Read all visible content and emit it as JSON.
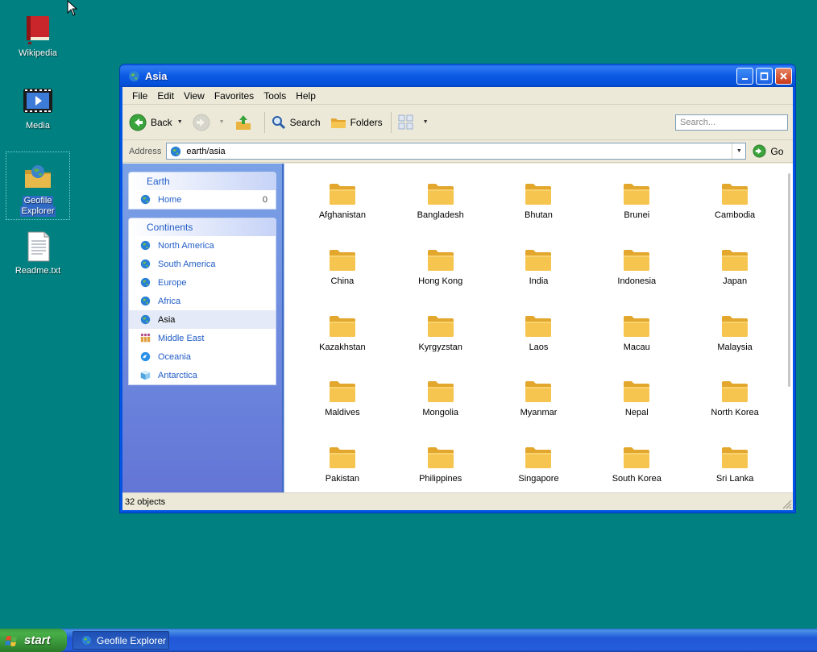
{
  "desktop": {
    "icons": [
      {
        "label": "Wikipedia"
      },
      {
        "label": "Media"
      },
      {
        "label": "Geofile\nExplorer",
        "line1": "Geofile",
        "line2": "Explorer"
      },
      {
        "label": "Readme.txt"
      }
    ]
  },
  "window": {
    "title": "Asia",
    "menu": [
      "File",
      "Edit",
      "View",
      "Favorites",
      "Tools",
      "Help"
    ],
    "toolbar": {
      "back_label": "Back",
      "search_label": "Search",
      "folders_label": "Folders",
      "search_placeholder": "Search..."
    },
    "address": {
      "label": "Address",
      "value": "earth/asia",
      "go_label": "Go"
    },
    "taskpane": {
      "earth": {
        "header": "Earth",
        "items": [
          {
            "label": "Home",
            "count": "0"
          }
        ]
      },
      "continents": {
        "header": "Continents",
        "items": [
          {
            "label": "North America",
            "icon": "globe-icon"
          },
          {
            "label": "South America",
            "icon": "globe-icon"
          },
          {
            "label": "Europe",
            "icon": "globe-icon"
          },
          {
            "label": "Africa",
            "icon": "globe-icon"
          },
          {
            "label": "Asia",
            "icon": "globe-icon",
            "active": true
          },
          {
            "label": "Middle East",
            "icon": "people-icon"
          },
          {
            "label": "Oceania",
            "icon": "wave-icon"
          },
          {
            "label": "Antarctica",
            "icon": "ice-icon"
          }
        ]
      }
    },
    "folders": [
      "Afghanistan",
      "Bangladesh",
      "Bhutan",
      "Brunei",
      "Cambodia",
      "China",
      "Hong Kong",
      "India",
      "Indonesia",
      "Japan",
      "Kazakhstan",
      "Kyrgyzstan",
      "Laos",
      "Macau",
      "Malaysia",
      "Maldives",
      "Mongolia",
      "Myanmar",
      "Nepal",
      "North Korea",
      "Pakistan",
      "Philippines",
      "Singapore",
      "South Korea",
      "Sri Lanka"
    ],
    "status": "32 objects"
  },
  "taskbar": {
    "start_label": "start",
    "task_label": "Geofile Explorer"
  },
  "colors": {
    "desktop": "#008080",
    "titlebar": "#0054e3",
    "taskpane": "#6d8fe0",
    "link": "#215dc6",
    "folder": "#f5c451"
  }
}
